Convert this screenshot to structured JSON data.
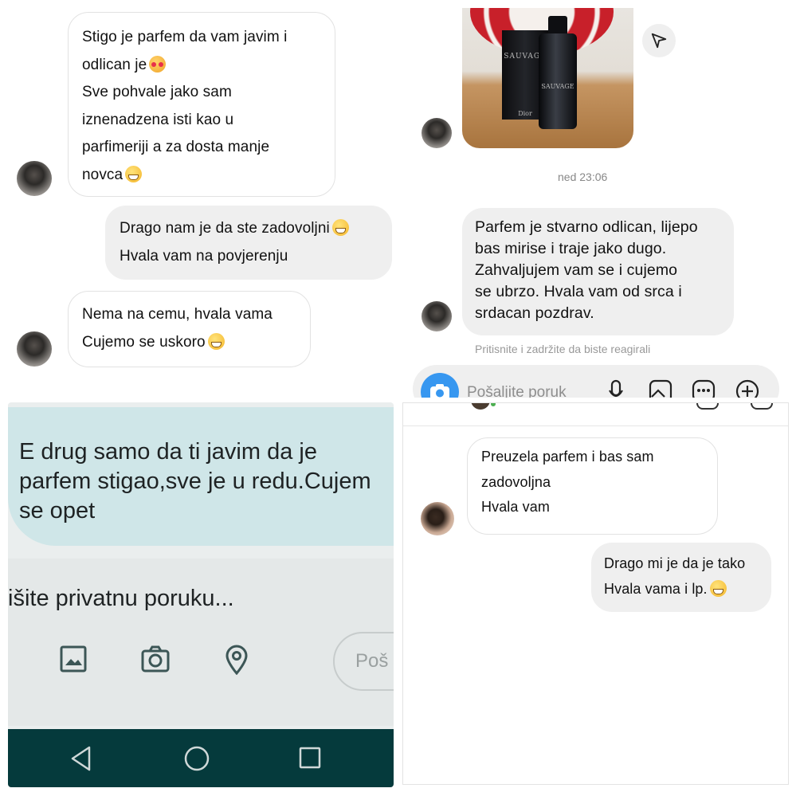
{
  "panel1": {
    "msg1": {
      "lines": [
        "Stigo je parfem da vam javim i",
        "odlican je",
        "Sve pohvale jako sam",
        "iznenadzena isti kao u",
        "parfimeriji a za dosta manje",
        "novca"
      ],
      "emojis": [
        "smiling-face-with-hearts",
        "grinning-face"
      ]
    },
    "reply1": {
      "lines": [
        "Drago nam je da ste zadovoljni",
        "Hvala vam na  povjerenju"
      ],
      "emoji": "grinning-face"
    },
    "msg2": {
      "lines": [
        "Nema na cemu, hvala vama",
        "Cujemo se uskoro"
      ],
      "emoji": "grinning-face"
    }
  },
  "panel2": {
    "photo": {
      "box_brand": "SAUVAGE",
      "box_maker": "Dior",
      "bottle_brand": "SAUVAGE"
    },
    "timestamp": "ned 23:06",
    "msg": {
      "lines": [
        "Parfem je stvarno odlican, lijepo",
        "bas mirise i traje jako dugo.",
        "Zahvaljujem vam se i cujemo",
        "se ubrzo. Hvala vam od srca i",
        "srdacan pozdrav."
      ]
    },
    "react_hint": "Pritisnite i zadržite da biste reagirali",
    "composer_placeholder": "Pošaljite poruk",
    "accent": "#3797f0"
  },
  "panel3": {
    "msg": {
      "lines": [
        "E drug samo da ti javim da je",
        "parfem stigao,sve je u redu.Cujem",
        "se opet"
      ]
    },
    "input_placeholder": "išite privatnu poruku...",
    "send_label": "Poš",
    "bubble_color": "#cfe6e8",
    "navbar_color": "#053a3c"
  },
  "panel4": {
    "msg": {
      "lines": [
        "Preuzela parfem i bas sam",
        "zadovoljna",
        "Hvala vam"
      ]
    },
    "reply": {
      "lines": [
        "Drago mi je da je tako",
        "Hvala vama i lp."
      ],
      "emoji": "grinning-face"
    }
  }
}
